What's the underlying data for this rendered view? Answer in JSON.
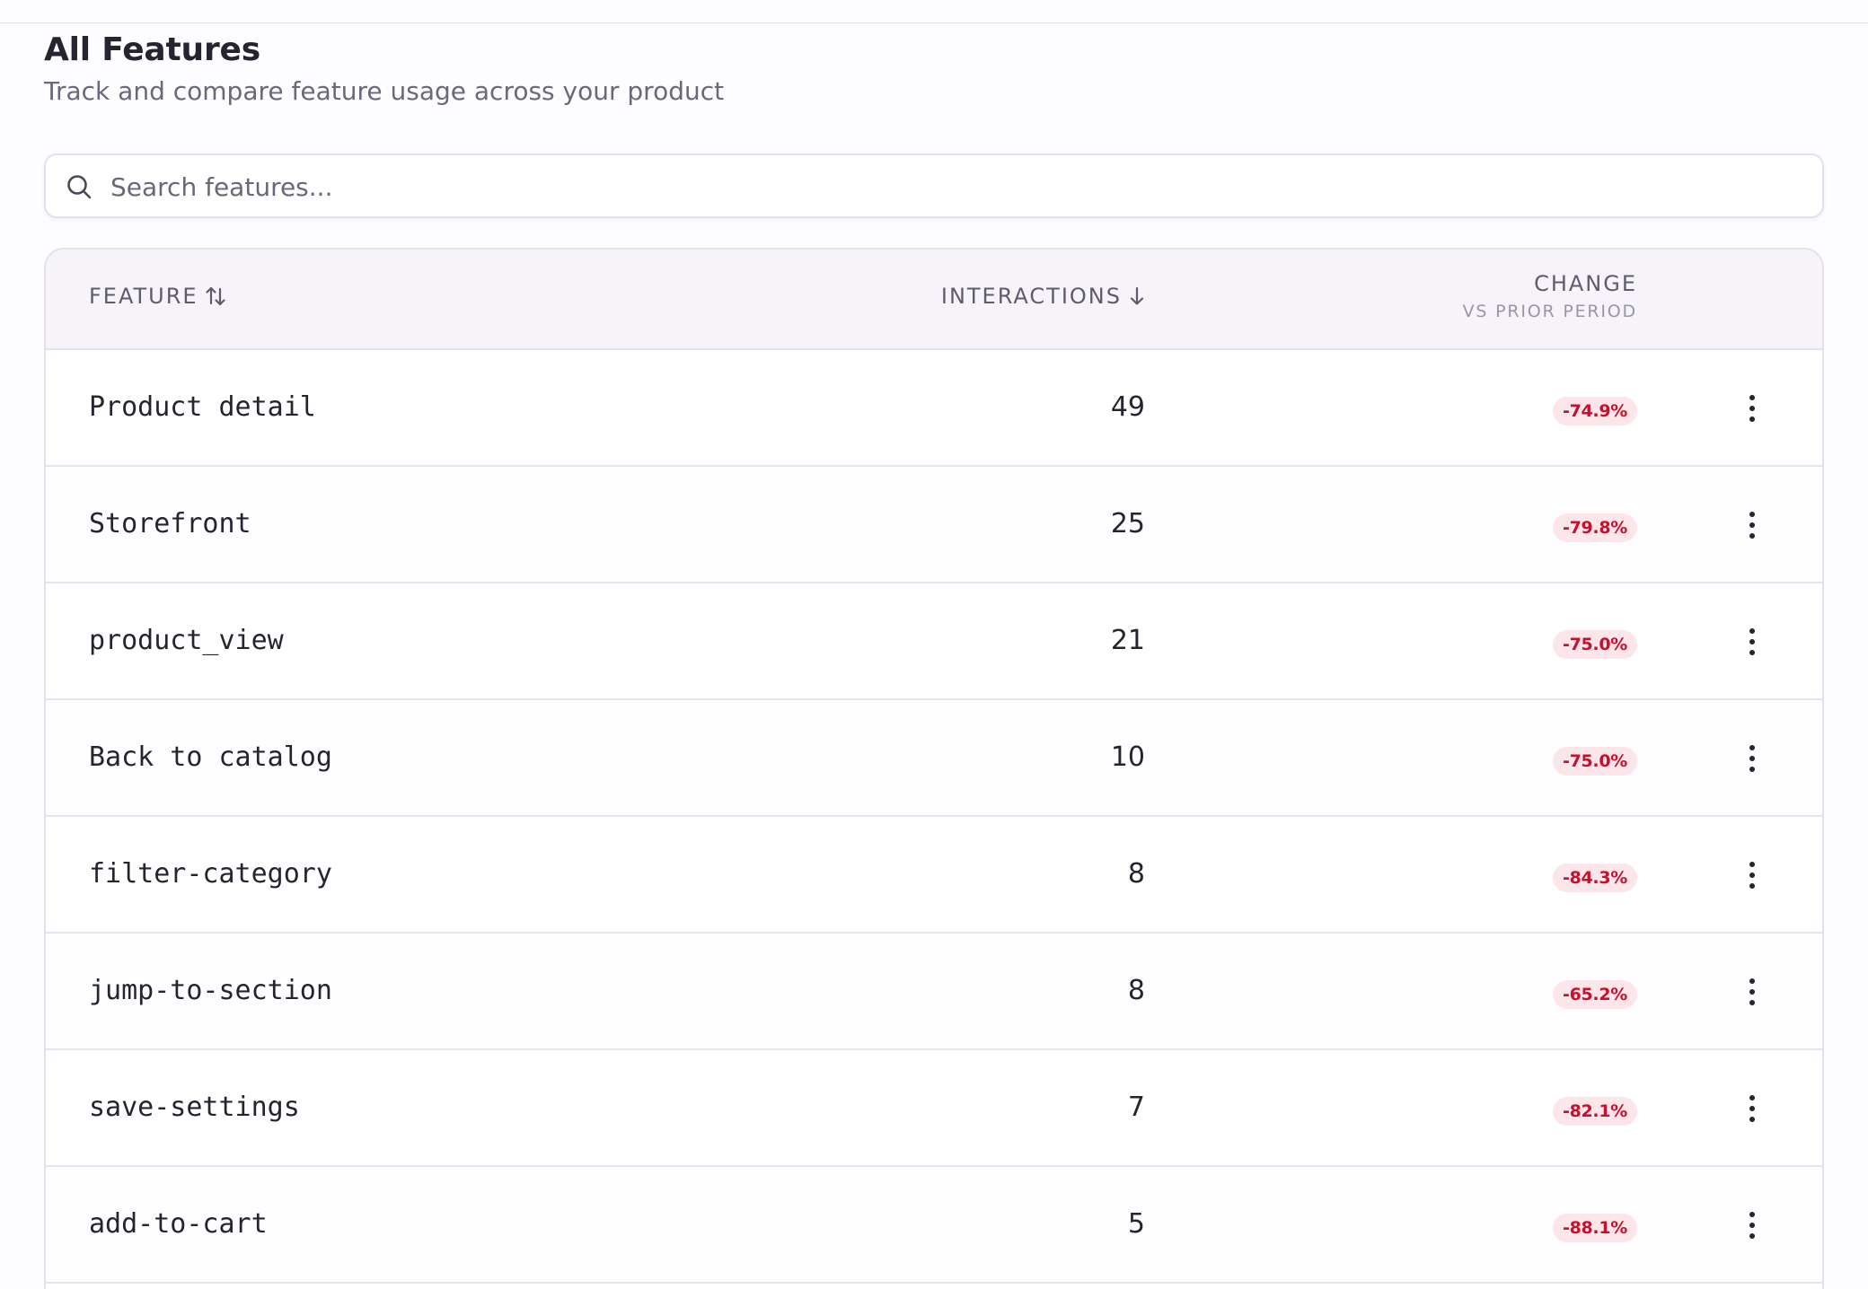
{
  "page": {
    "title": "All Features",
    "subtitle": "Track and compare feature usage across your product"
  },
  "search": {
    "placeholder": "Search features...",
    "value": ""
  },
  "table": {
    "columns": {
      "feature": "FEATURE",
      "interactions": "INTERACTIONS",
      "change": "CHANGE",
      "change_sub": "VS PRIOR PERIOD"
    },
    "sort": {
      "feature_icon": "sort-both-icon",
      "interactions_icon": "sort-descending-icon"
    },
    "rows": [
      {
        "feature": "Product detail",
        "interactions": "49",
        "change": "-74.9%"
      },
      {
        "feature": "Storefront",
        "interactions": "25",
        "change": "-79.8%"
      },
      {
        "feature": "product_view",
        "interactions": "21",
        "change": "-75.0%"
      },
      {
        "feature": "Back to catalog",
        "interactions": "10",
        "change": "-75.0%"
      },
      {
        "feature": "filter-category",
        "interactions": "8",
        "change": "-84.3%"
      },
      {
        "feature": "jump-to-section",
        "interactions": "8",
        "change": "-65.2%"
      },
      {
        "feature": "save-settings",
        "interactions": "7",
        "change": "-82.1%"
      },
      {
        "feature": "add-to-cart",
        "interactions": "5",
        "change": "-88.1%"
      }
    ]
  },
  "colors": {
    "negative_text": "#c8102e",
    "negative_bg": "#fde6ea",
    "header_bg": "#f6f4f9",
    "border": "#e4e1ec"
  }
}
